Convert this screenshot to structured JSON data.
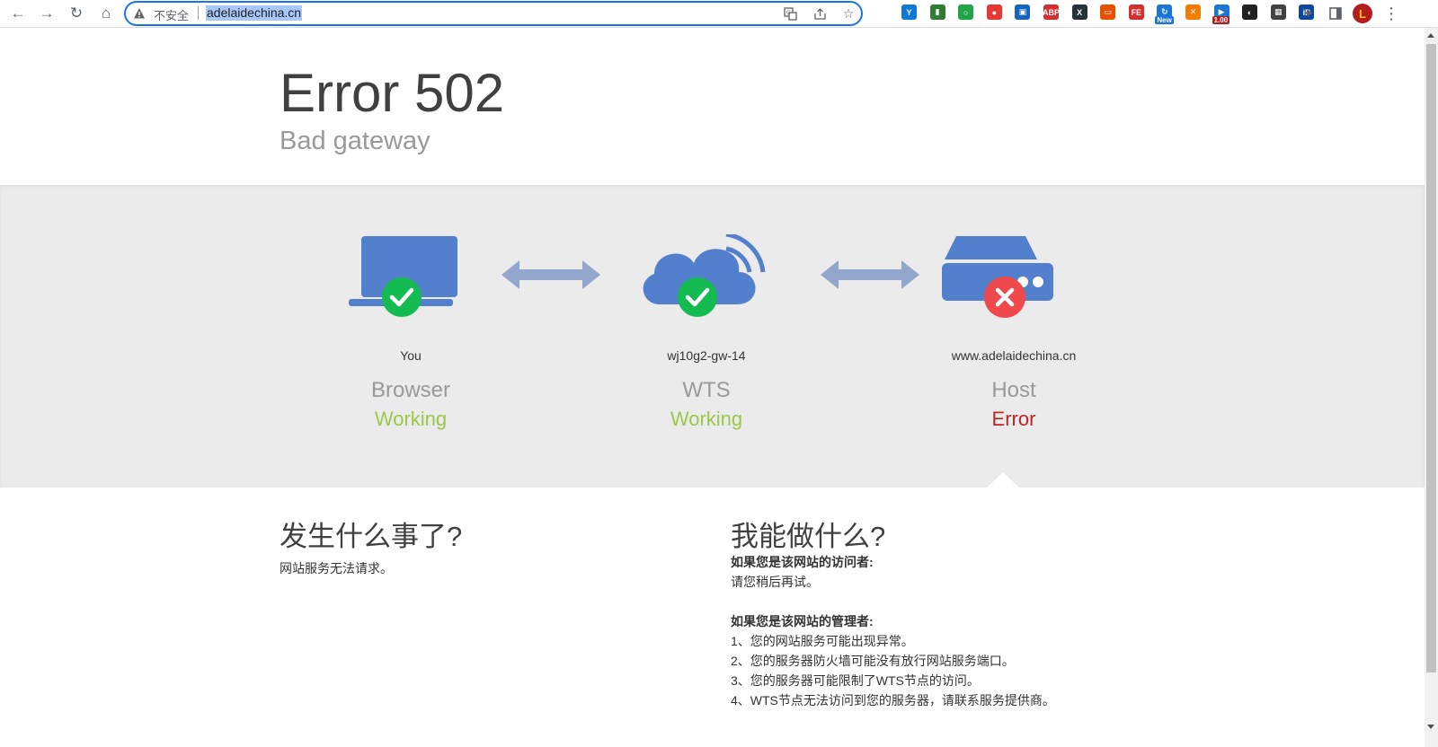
{
  "browser": {
    "insecure_label": "不安全",
    "url": "adelaidechina.cn",
    "extensions": [
      {
        "name": "vpn-extension-icon",
        "glyph": "Y",
        "color": "#0f7ad6"
      },
      {
        "name": "stats-extension-icon",
        "glyph": "▮",
        "color": "#2e7d32"
      },
      {
        "name": "green-ring-extension-icon",
        "glyph": "○",
        "color": "#22a447"
      },
      {
        "name": "color-picker-extension-icon",
        "glyph": "●",
        "color": "#e53935"
      },
      {
        "name": "save-extension-icon",
        "glyph": "▣",
        "color": "#1565c0"
      },
      {
        "name": "adblock-plus-extension-icon",
        "glyph": "ABP",
        "color": "#d32f2f"
      },
      {
        "name": "x-extension-icon",
        "glyph": "X",
        "color": "#263238"
      },
      {
        "name": "window-extension-icon",
        "glyph": "▭",
        "color": "#e65100"
      },
      {
        "name": "fe-extension-icon",
        "glyph": "FE",
        "color": "#d32f2f"
      },
      {
        "name": "new-extension-icon",
        "glyph": "↻",
        "color": "#1976d2",
        "badge": "New"
      },
      {
        "name": "orange-x-extension-icon",
        "glyph": "✕",
        "color": "#f57c00"
      },
      {
        "name": "speed-extension-icon",
        "glyph": "▶",
        "color": "#1976d2",
        "badge": "1.00"
      },
      {
        "name": "mask-extension-icon",
        "glyph": "◐",
        "color": "#212121"
      },
      {
        "name": "qr-code-extension-icon",
        "glyph": "▦",
        "color": "#424242"
      },
      {
        "name": "ip-extension-icon",
        "glyph": "iP",
        "color": "#0d47a1"
      }
    ],
    "profile_initial": "L"
  },
  "error": {
    "code": "Error 502",
    "description": "Bad gateway"
  },
  "nodes": [
    {
      "label": "You",
      "name": "Browser",
      "status": "Working",
      "status_color": "#9bc74a"
    },
    {
      "label": "wj10g2-gw-14",
      "name": "WTS",
      "status": "Working",
      "status_color": "#9bc74a"
    },
    {
      "label": "www.adelaidechina.cn",
      "name": "Host",
      "status": "Error",
      "status_color": "#bd2426"
    }
  ],
  "colors": {
    "icon_blue": "#5280cc",
    "arrow_blue": "#93a6ce",
    "ok_green": "#13bb50",
    "err_red": "#f0494c"
  },
  "what_happened": {
    "title": "发生什么事了?",
    "text": "网站服务无法请求。"
  },
  "what_can_i_do": {
    "title": "我能做什么?",
    "visitor_heading": "如果您是该网站的访问者:",
    "visitor_text": "请您稍后再试。",
    "admin_heading": "如果您是该网站的管理者:",
    "admin_items": [
      "1、您的网站服务可能出现异常。",
      "2、您的服务器防火墙可能没有放行网站服务端口。",
      "3、您的服务器可能限制了WTS节点的访问。",
      "4、WTS节点无法访问到您的服务器，请联系服务提供商。"
    ]
  }
}
